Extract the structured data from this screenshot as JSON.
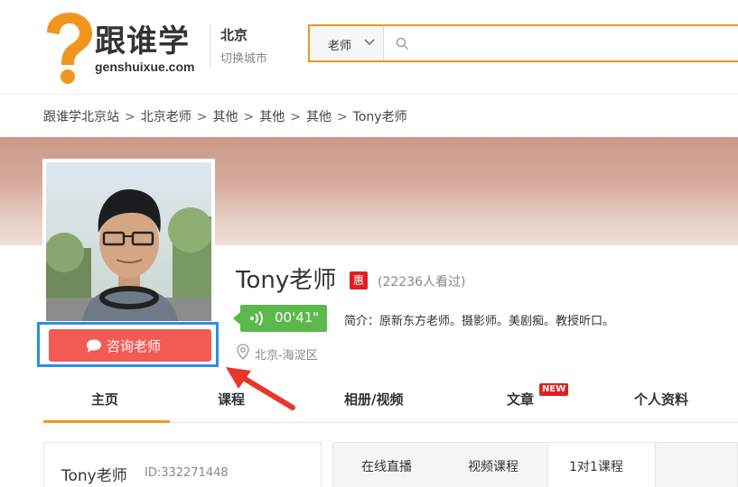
{
  "header": {
    "logo_text": "跟谁学",
    "logo_sub": "genshuixue.com",
    "city": "北京",
    "city_switch": "切换城市",
    "search": {
      "category": "老师",
      "placeholder": ""
    }
  },
  "breadcrumb": [
    "跟谁学北京站",
    "北京老师",
    "其他",
    "其他",
    "其他",
    "Tony老师"
  ],
  "breadcrumb_sep": ">",
  "profile": {
    "name": "Tony老师",
    "badge": "惠",
    "views": "(22236人看过)",
    "audio_duration": "00'41\"",
    "intro": "简介：原新东方老师。摄影师。美剧痴。教授听口。",
    "location": "北京-海淀区",
    "consult_button": "咨询老师"
  },
  "tabs": [
    {
      "label": "主页",
      "active": true
    },
    {
      "label": "课程"
    },
    {
      "label": "相册/视频"
    },
    {
      "label": "文章",
      "badge": "NEW"
    },
    {
      "label": "个人资料"
    }
  ],
  "info_card": {
    "name": "Tony老师",
    "id": "ID:332271448"
  },
  "course_tabs": [
    "在线直播",
    "视频课程",
    "1对1课程"
  ],
  "colors": {
    "accent_orange": "#f0961e",
    "consult_red": "#f25b56",
    "audio_green": "#5ab94a",
    "highlight_blue": "#2b8ee6"
  }
}
